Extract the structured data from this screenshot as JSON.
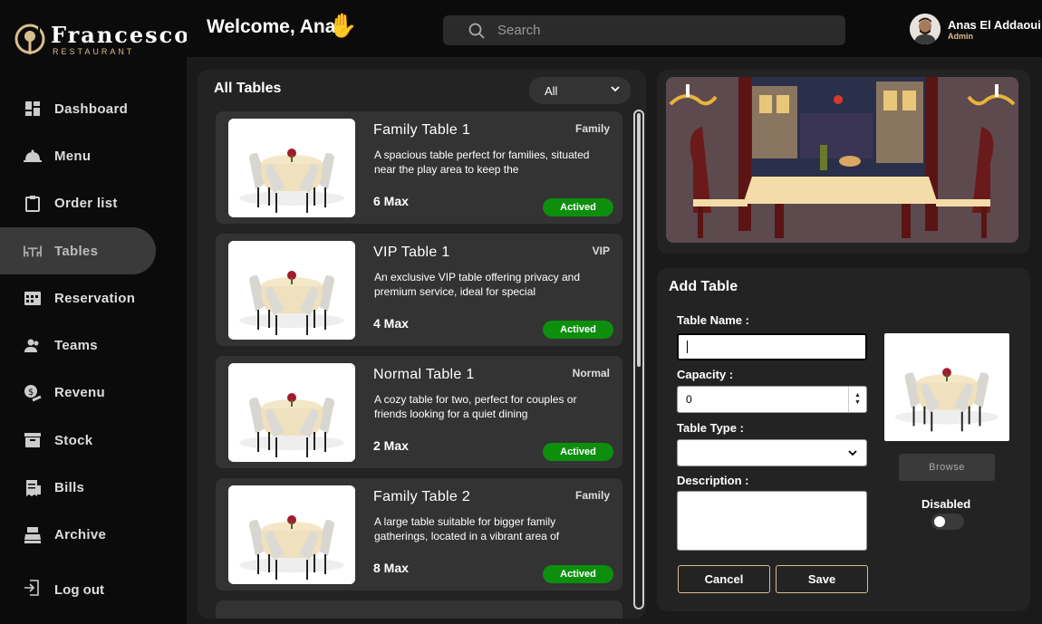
{
  "app": {
    "name": "Francesco",
    "subtitle": "RESTAURANT"
  },
  "colors": {
    "accent": "#d9bd8c",
    "active_status": "#0d8f0d",
    "sidebar_bg": "#0b0b0b",
    "main_bg": "#1a1a1a",
    "panel_bg": "#232323"
  },
  "header": {
    "welcome": "Welcome, Anas",
    "wave_icon": "waving-hand-icon",
    "search_placeholder": "Search",
    "user_name": "Anas El Addaoui",
    "user_role": "Admin"
  },
  "sidebar": {
    "items": [
      {
        "label": "Dashboard",
        "icon": "dashboard-icon",
        "active": false
      },
      {
        "label": "Menu",
        "icon": "cloche-icon",
        "active": false
      },
      {
        "label": "Order list",
        "icon": "clipboard-icon",
        "active": false
      },
      {
        "label": "Tables",
        "icon": "table-icon",
        "active": true
      },
      {
        "label": "Reservation",
        "icon": "calendar-icon",
        "active": false
      },
      {
        "label": "Teams",
        "icon": "users-icon",
        "active": false
      },
      {
        "label": "Revenu",
        "icon": "money-hand-icon",
        "active": false
      },
      {
        "label": "Stock",
        "icon": "archive-box-icon",
        "active": false
      },
      {
        "label": "Bills",
        "icon": "receipt-icon",
        "active": false
      },
      {
        "label": "Archive",
        "icon": "cash-register-icon",
        "active": false
      }
    ],
    "logout": "Log out"
  },
  "tables_panel": {
    "title": "All Tables",
    "filter_value": "All",
    "tables": [
      {
        "name": "Family Table 1",
        "type": "Family",
        "description": "A spacious table perfect for families, situated near the play area to keep the",
        "capacity": "6 Max",
        "status": "Actived"
      },
      {
        "name": "VIP Table 1",
        "type": "VIP",
        "description": "An exclusive VIP table offering privacy and premium service, ideal for special",
        "capacity": "4 Max",
        "status": "Actived"
      },
      {
        "name": "Normal Table 1",
        "type": "Normal",
        "description": "A cozy table for two, perfect for couples or friends looking for a quiet dining",
        "capacity": "2 Max",
        "status": "Actived"
      },
      {
        "name": "Family Table 2",
        "type": "Family",
        "description": "A large table suitable for bigger family gatherings, located in a vibrant area of",
        "capacity": "8 Max",
        "status": "Actived"
      }
    ]
  },
  "form": {
    "title": "Add Table",
    "table_name_label": "Table Name :",
    "table_name_value": "",
    "capacity_label": "Capacity :",
    "capacity_value": "0",
    "table_type_label": "Table Type :",
    "table_type_value": "",
    "description_label": "Description :",
    "description_value": "",
    "cancel": "Cancel",
    "save": "Save",
    "browse": "Browse",
    "disabled_label": "Disabled",
    "disabled_on": false
  }
}
